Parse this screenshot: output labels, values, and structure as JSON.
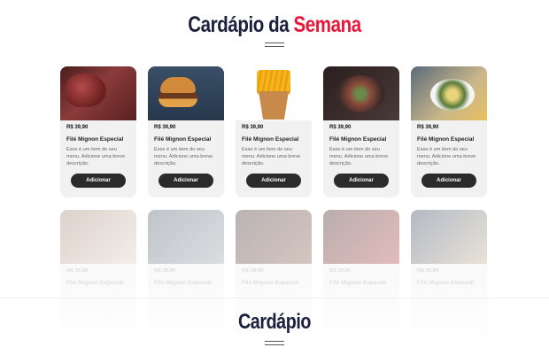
{
  "week_section": {
    "title_part1": "Cardápio da",
    "title_accent": "Semana"
  },
  "menu_section": {
    "title": "Cardápio"
  },
  "featured_items": [
    {
      "price": "R$ 39,90",
      "name": "Filé Mignon Especial",
      "description": "Esse é um item do seu menu. Adicione uma breve descrição.",
      "button": "Adicionar",
      "image": "steak"
    },
    {
      "price": "R$ 39,90",
      "name": "Filé Mignon Especial",
      "description": "Esse é um item do seu menu. Adicione uma breve descrição.",
      "button": "Adicionar",
      "image": "burger"
    },
    {
      "price": "R$ 39,90",
      "name": "Filé Mignon Especial",
      "description": "Esse é um item do seu menu. Adicione uma breve descrição.",
      "button": "Adicionar",
      "image": "fries"
    },
    {
      "price": "R$ 39,90",
      "name": "Filé Mignon Especial",
      "description": "Esse é um item do seu menu. Adicione uma breve descrição.",
      "button": "Adicionar",
      "image": "steak-plate"
    },
    {
      "price": "R$ 39,90",
      "name": "Filé Mignon Especial",
      "description": "Esse é um item do seu menu. Adicione uma breve descrição.",
      "button": "Adicionar",
      "image": "dish-plate"
    }
  ],
  "faded_items": [
    {
      "price": "R$ 39,90",
      "name": "Filé Mignon Especial"
    },
    {
      "price": "R$ 39,90",
      "name": "Filé Mignon Especial"
    },
    {
      "price": "R$ 39,90",
      "name": "Filé Mignon Especial"
    },
    {
      "price": "R$ 39,90",
      "name": "Filé Mignon Especial"
    },
    {
      "price": "R$ 39,90",
      "name": "Filé Mignon Especial"
    }
  ],
  "colors": {
    "title": "#1b1f3b",
    "accent": "#e8173a",
    "button": "#2b2b2b",
    "card": "#f1f1f1"
  }
}
